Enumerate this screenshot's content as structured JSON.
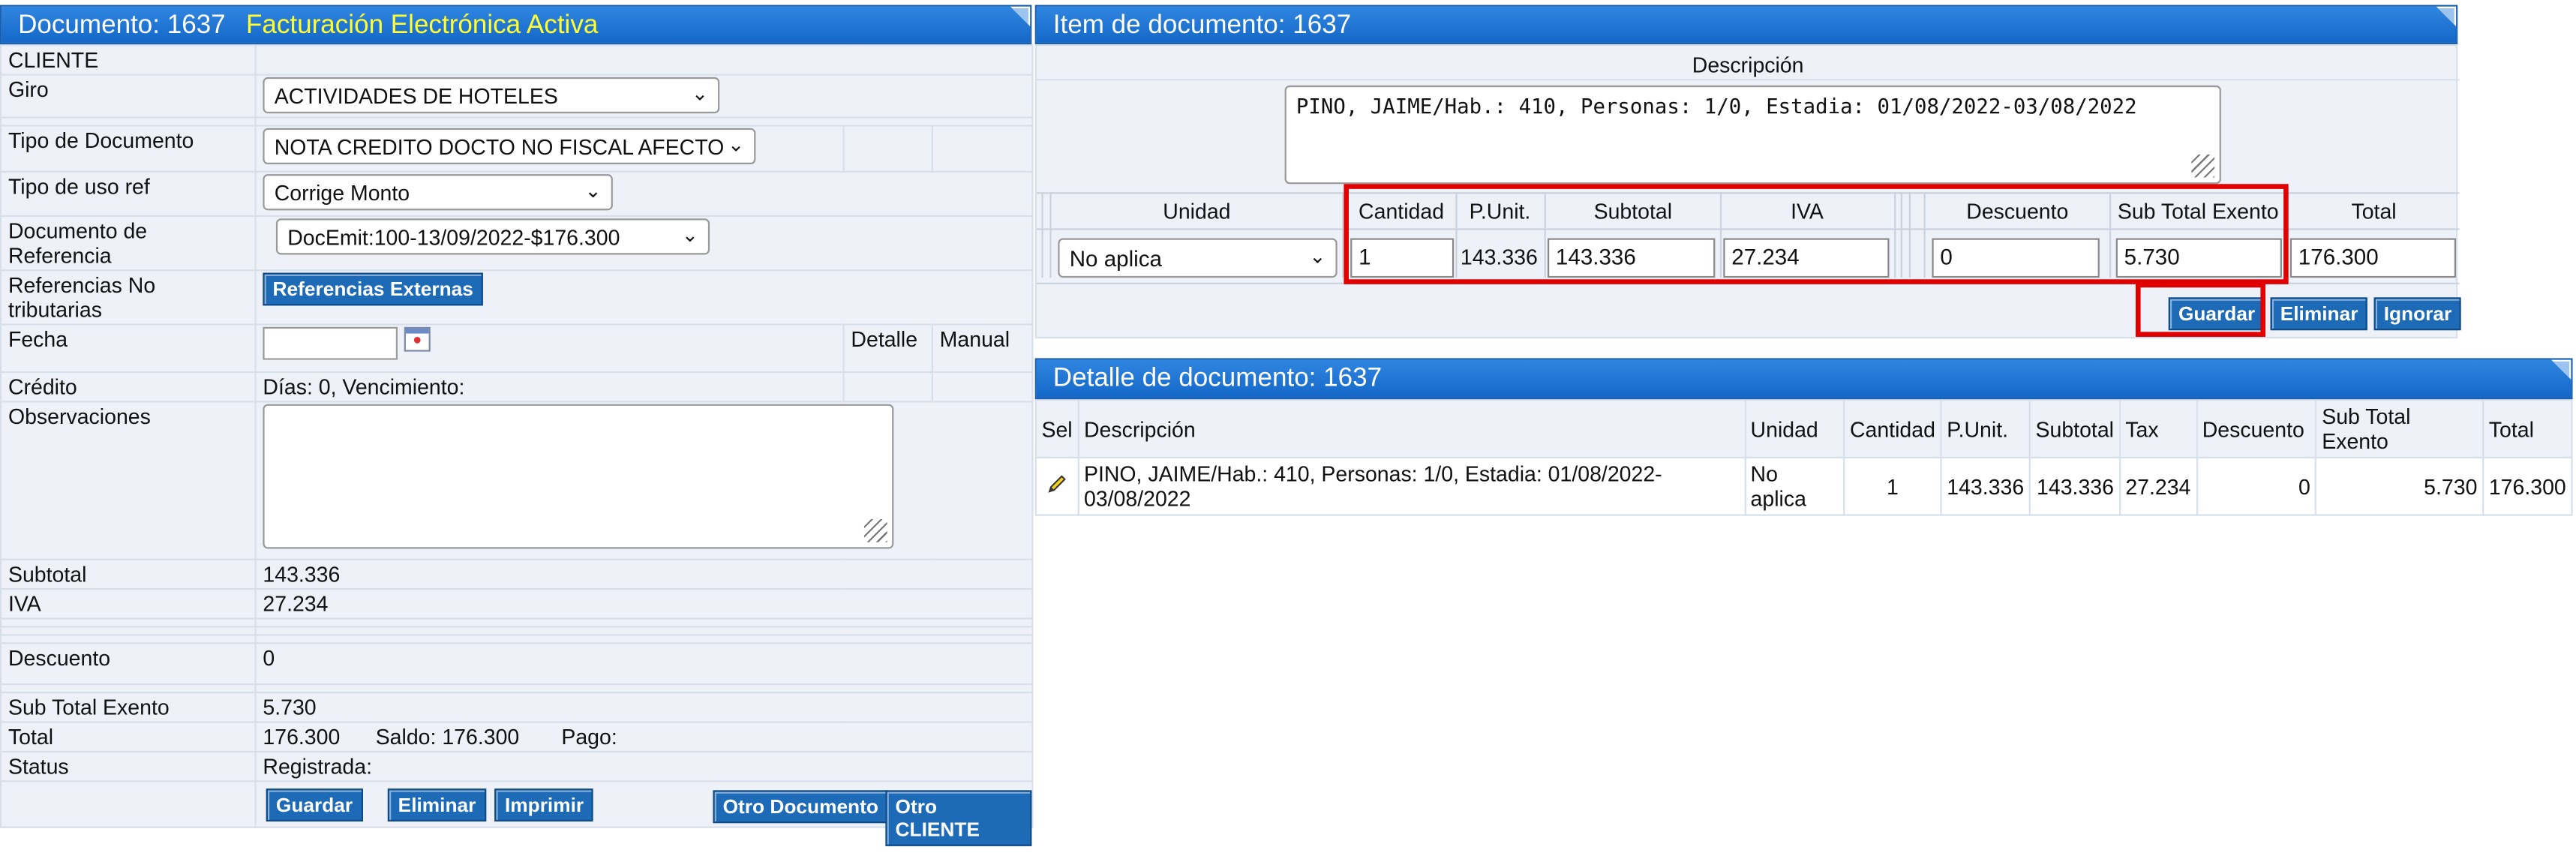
{
  "left": {
    "title": "Documento: 1637",
    "subtitle": "Facturación Electrónica Activa",
    "cliente_label": "CLIENTE",
    "giro_label": "Giro",
    "giro_value": "ACTIVIDADES DE HOTELES",
    "tipo_doc_label": "Tipo de Documento",
    "tipo_doc_value": "NOTA CREDITO DOCTO NO FISCAL AFECTO",
    "tipo_uso_label": "Tipo de uso ref",
    "tipo_uso_value": "Corrige Monto",
    "doc_ref_label": "Documento de Referencia",
    "doc_ref_value": "DocEmit:100-13/09/2022-$176.300",
    "ref_no_trib_label": "Referencias No tributarias",
    "ref_externas_button": "Referencias Externas",
    "fecha_label": "Fecha",
    "fecha_value": "",
    "detalle_label": "Detalle",
    "manual_label": "Manual",
    "credito_label": "Crédito",
    "credito_value": "Días: 0, Vencimiento:",
    "observaciones_label": "Observaciones",
    "observaciones_value": "",
    "subtotal_label": "Subtotal",
    "subtotal_value": "143.336",
    "iva_label": "IVA",
    "iva_value": "27.234",
    "descuento_label": "Descuento",
    "descuento_value": "0",
    "subtotal_exento_label": "Sub Total Exento",
    "subtotal_exento_value": "5.730",
    "total_label": "Total",
    "total_value": "176.300",
    "saldo_text": "Saldo: 176.300",
    "pago_text": "Pago:",
    "status_label": "Status",
    "status_value": "Registrada:",
    "buttons": {
      "guardar": "Guardar",
      "eliminar": "Eliminar",
      "imprimir": "Imprimir",
      "otro_documento": "Otro Documento",
      "otro_cliente": "Otro CLIENTE"
    }
  },
  "item": {
    "title": "Item de documento: 1637",
    "descripcion_label": "Descripción",
    "descripcion_value": "PINO, JAIME/Hab.: 410, Personas: 1/0, Estadia: 01/08/2022-03/08/2022",
    "headers": {
      "unidad": "Unidad",
      "cantidad": "Cantidad",
      "punit": "P.Unit.",
      "subtotal": "Subtotal",
      "iva": "IVA",
      "descuento": "Descuento",
      "subtotal_exento": "Sub Total Exento",
      "total": "Total"
    },
    "unidad_value": "No aplica",
    "cantidad_value": "1",
    "punit_value": "143.336",
    "subtotal_value": "143.336",
    "iva_value": "27.234",
    "descuento_value": "0",
    "subtotal_exento_value": "5.730",
    "total_value": "176.300",
    "buttons": {
      "guardar": "Guardar",
      "eliminar": "Eliminar",
      "ignorar": "Ignorar"
    }
  },
  "detail": {
    "title": "Detalle de documento: 1637",
    "columns": [
      "Sel",
      "Descripción",
      "Unidad",
      "Cantidad",
      "P.Unit.",
      "Subtotal",
      "Tax",
      "Descuento",
      "Sub Total Exento",
      "Total"
    ],
    "rows": [
      {
        "descripcion": "PINO, JAIME/Hab.: 410, Personas: 1/0, Estadia: 01/08/2022-03/08/2022",
        "unidad": "No aplica",
        "cantidad": "1",
        "punit": "143.336",
        "subtotal": "143.336",
        "tax": "27.234",
        "descuento": "0",
        "subtotal_exento": "5.730",
        "total": "176.300"
      }
    ]
  },
  "colors": {
    "header_blue": "#1467c7",
    "button_blue": "#1d6ab7",
    "highlight_red": "#e00000",
    "subtitle_yellow": "#ffff33"
  }
}
